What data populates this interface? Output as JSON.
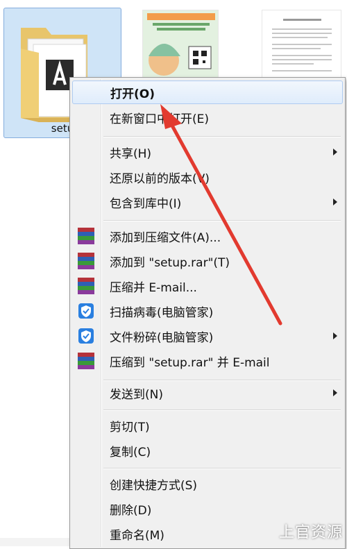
{
  "explorer": {
    "selected_file": "setu"
  },
  "context_menu": {
    "items": [
      {
        "label": "打开(O)",
        "has_submenu": false,
        "icon": null
      },
      {
        "label": "在新窗口中打开(E)",
        "has_submenu": false,
        "icon": null
      },
      {
        "label": "共享(H)",
        "has_submenu": true,
        "icon": null
      },
      {
        "label": "还原以前的版本(V)",
        "has_submenu": false,
        "icon": null
      },
      {
        "label": "包含到库中(I)",
        "has_submenu": true,
        "icon": null
      },
      {
        "label": "添加到压缩文件(A)...",
        "has_submenu": false,
        "icon": "winrar-icon"
      },
      {
        "label": "添加到 \"setup.rar\"(T)",
        "has_submenu": false,
        "icon": "winrar-icon"
      },
      {
        "label": "压缩并 E-mail...",
        "has_submenu": false,
        "icon": "winrar-icon"
      },
      {
        "label": "扫描病毒(电脑管家)",
        "has_submenu": false,
        "icon": "shield-icon"
      },
      {
        "label": "文件粉碎(电脑管家)",
        "has_submenu": true,
        "icon": "shield-icon"
      },
      {
        "label": "压缩到 \"setup.rar\" 并 E-mail",
        "has_submenu": false,
        "icon": "winrar-icon"
      },
      {
        "label": "发送到(N)",
        "has_submenu": true,
        "icon": null
      },
      {
        "label": "剪切(T)",
        "has_submenu": false,
        "icon": null
      },
      {
        "label": "复制(C)",
        "has_submenu": false,
        "icon": null
      },
      {
        "label": "创建快捷方式(S)",
        "has_submenu": false,
        "icon": null
      },
      {
        "label": "删除(D)",
        "has_submenu": false,
        "icon": null
      },
      {
        "label": "重命名(M)",
        "has_submenu": false,
        "icon": null
      }
    ]
  },
  "watermark": "上官资源",
  "colors": {
    "selection_bg": "#cfe4f7",
    "menu_bg": "#f0f0f0",
    "arrow_red": "#e23a2f",
    "shield_blue": "#2a7fe0"
  }
}
